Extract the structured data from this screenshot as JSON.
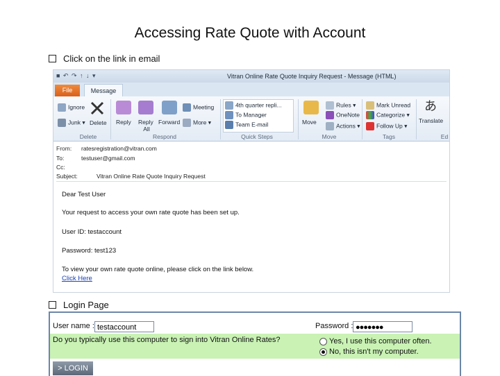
{
  "slide": {
    "title": "Accessing Rate Quote with Account",
    "bullet1": "Click on the link in email",
    "bullet2": "Login Page"
  },
  "outlook": {
    "quick_access": "■ ↶ ↷ ↑ ↓ ▾",
    "window_title": "Vitran Online Rate Quote Inquiry Request - Message (HTML)",
    "tabs": {
      "file": "File",
      "message": "Message"
    },
    "ribbon": {
      "ignore": "Ignore",
      "junk": "Junk ▾",
      "delete": "Delete",
      "reply": "Reply",
      "reply_all_1": "Reply",
      "reply_all_2": "All",
      "forward": "Forward",
      "meeting": "Meeting",
      "more": "More ▾",
      "qs_1": "4th quarter repli...",
      "qs_2": "To Manager",
      "qs_3": "Team E-mail",
      "move": "Move",
      "rules": "Rules ▾",
      "onenote": "OneNote",
      "actions": "Actions ▾",
      "mark_unread": "Mark Unread",
      "categorize": "Categorize ▾",
      "follow_up": "Follow Up ▾",
      "translate": "Translate",
      "groups": {
        "delete": "Delete",
        "respond": "Respond",
        "quick_steps": "Quick Steps",
        "move": "Move",
        "tags": "Tags",
        "editing": "Ed"
      }
    },
    "headers": {
      "from_label": "From:",
      "from_value": "ratesregistration@vitran.com",
      "to_label": "To:",
      "to_value": "testuser@gmail.com",
      "cc_label": "Cc:",
      "subject_label": "Subject:",
      "subject_value": "Vitran Online Rate Quote Inquiry Request"
    },
    "body": {
      "greeting": "Dear Test User",
      "line1": "Your request to access your own rate quote has been set up.",
      "userid": "User ID: testaccount",
      "password": "Password: test123",
      "line2": "To view your own rate quote online, please click on the link below.",
      "link": "Click Here"
    }
  },
  "login": {
    "username_label": "User name :",
    "username_value": "testaccount",
    "password_label": "Password :",
    "password_value": "●●●●●●●",
    "question": "Do you typically use this computer to sign into Vitran Online Rates?",
    "option_yes": "Yes, I use this computer often.",
    "option_no": "No, this isn't my computer.",
    "selected": "no",
    "button": "> LOGIN"
  }
}
